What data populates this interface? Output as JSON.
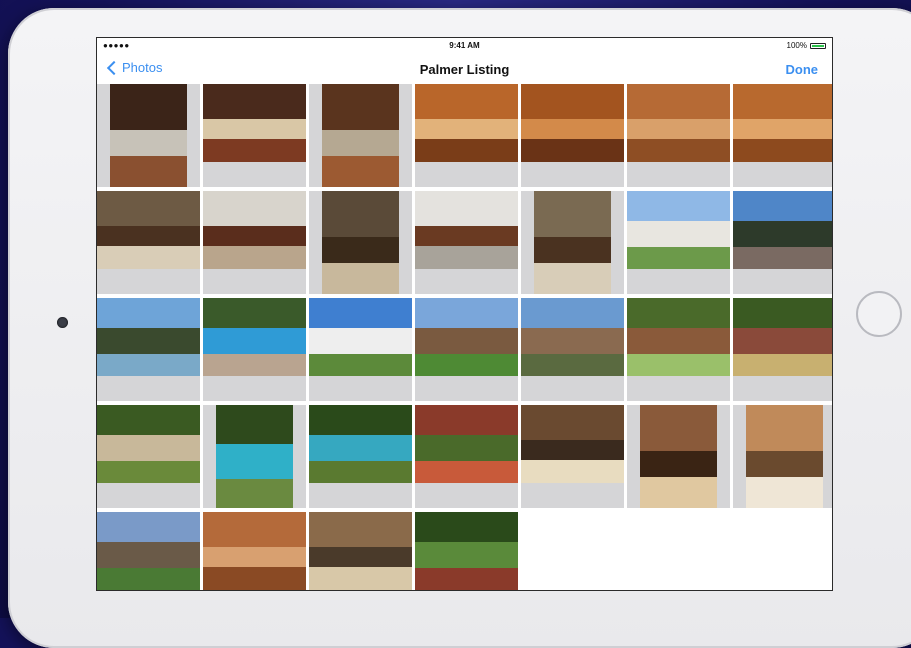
{
  "status_bar": {
    "signal": "●●●●● ",
    "time": "9:41 AM",
    "battery": "100%"
  },
  "nav": {
    "back_label": "Photos",
    "title": "Palmer Listing",
    "done_label": "Done"
  },
  "photos": [
    {
      "kind": "kitchen",
      "fit": "portrait",
      "colors": [
        "#3b2418",
        "#8a5030",
        "#c7c2b8"
      ],
      "selected": false
    },
    {
      "kind": "kitchen",
      "fit": "landscape",
      "colors": [
        "#4a2a1c",
        "#7d3a22",
        "#d9c7a6"
      ],
      "selected": false
    },
    {
      "kind": "kitchen",
      "fit": "portrait",
      "colors": [
        "#5a341e",
        "#9c5a32",
        "#b5a892"
      ],
      "selected": false
    },
    {
      "kind": "kitchen",
      "fit": "landscape",
      "colors": [
        "#b9662a",
        "#7a3d18",
        "#e2b27a"
      ],
      "selected": false
    },
    {
      "kind": "kitchen",
      "fit": "landscape",
      "colors": [
        "#a3541f",
        "#6a3316",
        "#d38a4a"
      ],
      "selected": false
    },
    {
      "kind": "kitchen",
      "fit": "landscape",
      "colors": [
        "#b66a35",
        "#8e4e24",
        "#d9a06a"
      ],
      "selected": false
    },
    {
      "kind": "kitchen",
      "fit": "landscape",
      "colors": [
        "#b8692e",
        "#8d4a1e",
        "#e0a468"
      ],
      "selected": false
    },
    {
      "kind": "living",
      "fit": "landscape",
      "colors": [
        "#6d5a44",
        "#d9cdb7",
        "#4a3120"
      ],
      "selected": false
    },
    {
      "kind": "living",
      "fit": "landscape",
      "colors": [
        "#d8d4cc",
        "#b9a58c",
        "#5a2d1c"
      ],
      "selected": false
    },
    {
      "kind": "living",
      "fit": "portrait",
      "colors": [
        "#5a4a38",
        "#c8b89c",
        "#3a2a1a"
      ],
      "selected": false
    },
    {
      "kind": "living",
      "fit": "landscape",
      "colors": [
        "#e4e2de",
        "#a8a39a",
        "#6a3a22"
      ],
      "selected": false
    },
    {
      "kind": "living",
      "fit": "portrait",
      "colors": [
        "#7a6a52",
        "#d8cdb8",
        "#4a3220"
      ],
      "selected": false
    },
    {
      "kind": "house",
      "fit": "landscape",
      "colors": [
        "#8fb8e6",
        "#e8e6e0",
        "#6c9a4a"
      ],
      "selected": false
    },
    {
      "kind": "pool",
      "fit": "landscape",
      "colors": [
        "#4f86c8",
        "#2d3a2a",
        "#7a6a62"
      ],
      "selected": false
    },
    {
      "kind": "pool",
      "fit": "landscape",
      "colors": [
        "#6ea4d8",
        "#3a4a2e",
        "#7aa9c8"
      ],
      "selected": false
    },
    {
      "kind": "pool",
      "fit": "landscape",
      "colors": [
        "#3a5a2a",
        "#2f9bd6",
        "#b9a490"
      ],
      "selected": false
    },
    {
      "kind": "house",
      "fit": "landscape",
      "colors": [
        "#3f7fd0",
        "#eeeeee",
        "#5c8a3a"
      ],
      "selected": false
    },
    {
      "kind": "house",
      "fit": "landscape",
      "colors": [
        "#7aa6da",
        "#7a5a40",
        "#4e8a34"
      ],
      "selected": false
    },
    {
      "kind": "house",
      "fit": "landscape",
      "colors": [
        "#6a9ad0",
        "#8a6a50",
        "#5a6a40"
      ],
      "selected": false
    },
    {
      "kind": "garden",
      "fit": "landscape",
      "colors": [
        "#4a6a2a",
        "#8a5a3a",
        "#9ac06a"
      ],
      "selected": false
    },
    {
      "kind": "garden",
      "fit": "landscape",
      "colors": [
        "#3a5a22",
        "#8a4a3a",
        "#c8b070"
      ],
      "selected": false
    },
    {
      "kind": "garden",
      "fit": "landscape",
      "colors": [
        "#3a5a22",
        "#c8b89a",
        "#6a8a3a"
      ],
      "selected": false
    },
    {
      "kind": "pool",
      "fit": "portrait",
      "colors": [
        "#2e4a1c",
        "#2fb0c8",
        "#6a8a40"
      ],
      "selected": false
    },
    {
      "kind": "pool",
      "fit": "landscape",
      "colors": [
        "#2a4a1a",
        "#36a8c0",
        "#5a7a30"
      ],
      "selected": false
    },
    {
      "kind": "garden",
      "fit": "landscape",
      "colors": [
        "#8a3a2a",
        "#4a6a2a",
        "#c85a3a"
      ],
      "selected": false
    },
    {
      "kind": "bath",
      "fit": "landscape",
      "colors": [
        "#6a4a30",
        "#e8dcc0",
        "#3a2a1e"
      ],
      "selected": false
    },
    {
      "kind": "bath",
      "fit": "portrait",
      "colors": [
        "#8a5a3a",
        "#e0c8a0",
        "#3a2414"
      ],
      "selected": false
    },
    {
      "kind": "bath",
      "fit": "portrait",
      "colors": [
        "#c08a5a",
        "#efe6d6",
        "#6a4a2e"
      ],
      "selected": false
    },
    {
      "kind": "house",
      "fit": "landscape",
      "colors": [
        "#7a9ac8",
        "#6a5a48",
        "#4a7a34"
      ],
      "selected": true
    },
    {
      "kind": "kitchen",
      "fit": "landscape",
      "colors": [
        "#b46a3a",
        "#8a4a24",
        "#d8a070"
      ],
      "selected": true
    },
    {
      "kind": "bath",
      "fit": "landscape",
      "colors": [
        "#8a6a4a",
        "#d8c8a8",
        "#4a3a2a"
      ],
      "selected": true
    },
    {
      "kind": "garden",
      "fit": "landscape",
      "colors": [
        "#2a4a1a",
        "#5a8a3a",
        "#8a3a2a"
      ],
      "selected": false
    }
  ]
}
